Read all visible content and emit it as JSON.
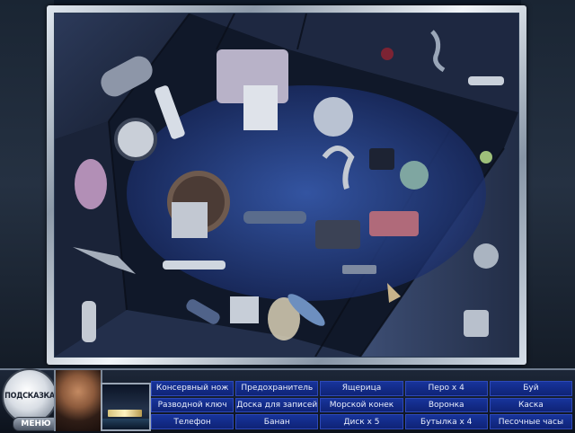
{
  "hint_button": {
    "label": "ПОДСКАЗКА"
  },
  "menu_button": {
    "label": "МЕНЮ"
  },
  "find_list": [
    "Консервный нож",
    "Предохранитель",
    "Ящерица",
    "Перо x 4",
    "Буй",
    "Разводной ключ",
    "Доска для записей",
    "Морской конек",
    "Воронка",
    "Каска",
    "Телефон",
    "Банан",
    "Диск x 5",
    "Бутылка x 4",
    "Песочные часы"
  ],
  "colors": {
    "list_bg": "#17349b",
    "list_text": "#e9eefc",
    "frame_metal": "#c8d1dc"
  }
}
